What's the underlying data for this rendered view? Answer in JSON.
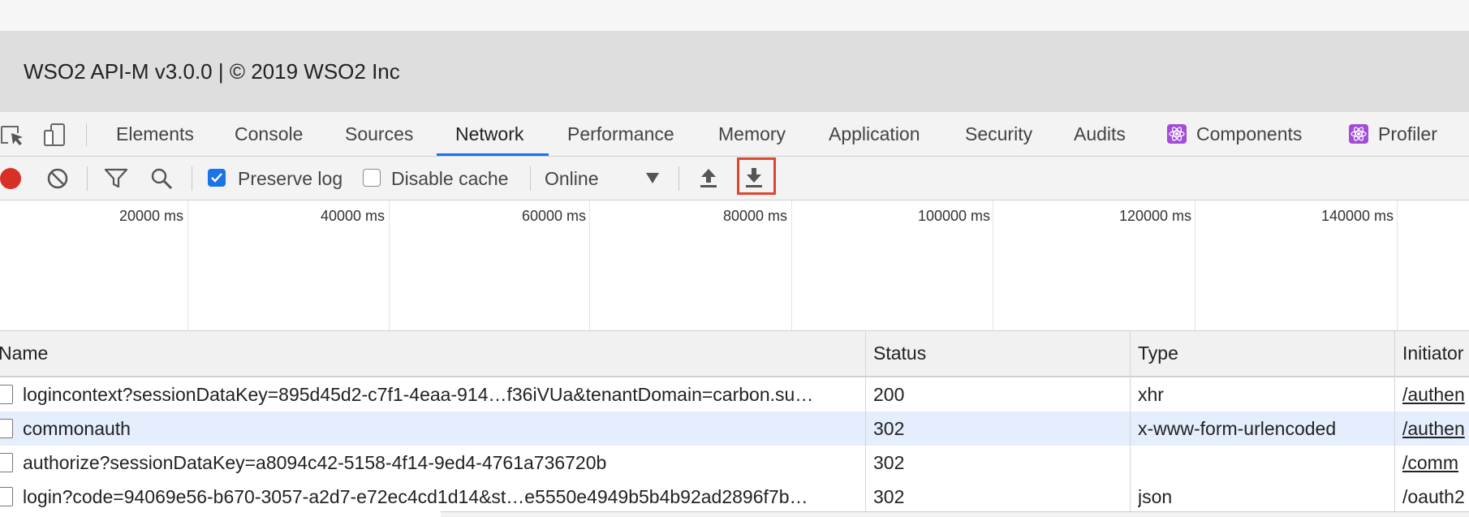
{
  "footer": {
    "text": "WSO2 API-M v3.0.0 | © 2019 WSO2 Inc"
  },
  "tabs": [
    {
      "label": "Elements"
    },
    {
      "label": "Console"
    },
    {
      "label": "Sources"
    },
    {
      "label": "Network",
      "active": true
    },
    {
      "label": "Performance"
    },
    {
      "label": "Memory"
    },
    {
      "label": "Application"
    },
    {
      "label": "Security"
    },
    {
      "label": "Audits"
    },
    {
      "label": "Components",
      "icon": "react-icon"
    },
    {
      "label": "Profiler",
      "icon": "react-icon"
    }
  ],
  "toolbar": {
    "preserve_log": {
      "label": "Preserve log",
      "checked": true
    },
    "disable_cache": {
      "label": "Disable cache",
      "checked": false
    },
    "throttling": "Online",
    "record_color": "#d93025",
    "highlight_color": "#e0452e"
  },
  "overview": {
    "labels": [
      "20000 ms",
      "40000 ms",
      "60000 ms",
      "80000 ms",
      "100000 ms",
      "120000 ms",
      "140000 ms"
    ]
  },
  "table": {
    "columns": [
      "Name",
      "Status",
      "Type",
      "Initiator"
    ],
    "rows": [
      {
        "name": "logincontext?sessionDataKey=895d45d2-c7f1-4eaa-914…f36iVUa&tenantDomain=carbon.su…",
        "status": "200",
        "type": "xhr",
        "initiator": "/authen",
        "selected": false,
        "initiator_link": true
      },
      {
        "name": "commonauth",
        "status": "302",
        "type": "x-www-form-urlencoded",
        "initiator": "/authen",
        "selected": true,
        "initiator_link": true
      },
      {
        "name": "authorize?sessionDataKey=a8094c42-5158-4f14-9ed4-4761a736720b",
        "status": "302",
        "type": "",
        "initiator": "/comm",
        "selected": false,
        "initiator_link": true
      },
      {
        "name": "login?code=94069e56-b670-3057-a2d7-e72ec4cd1d14&st…e5550e4949b5b4b92ad2896f7b…",
        "status": "302",
        "type": "json",
        "initiator": "/oauth2",
        "selected": false,
        "initiator_link": false
      }
    ]
  }
}
